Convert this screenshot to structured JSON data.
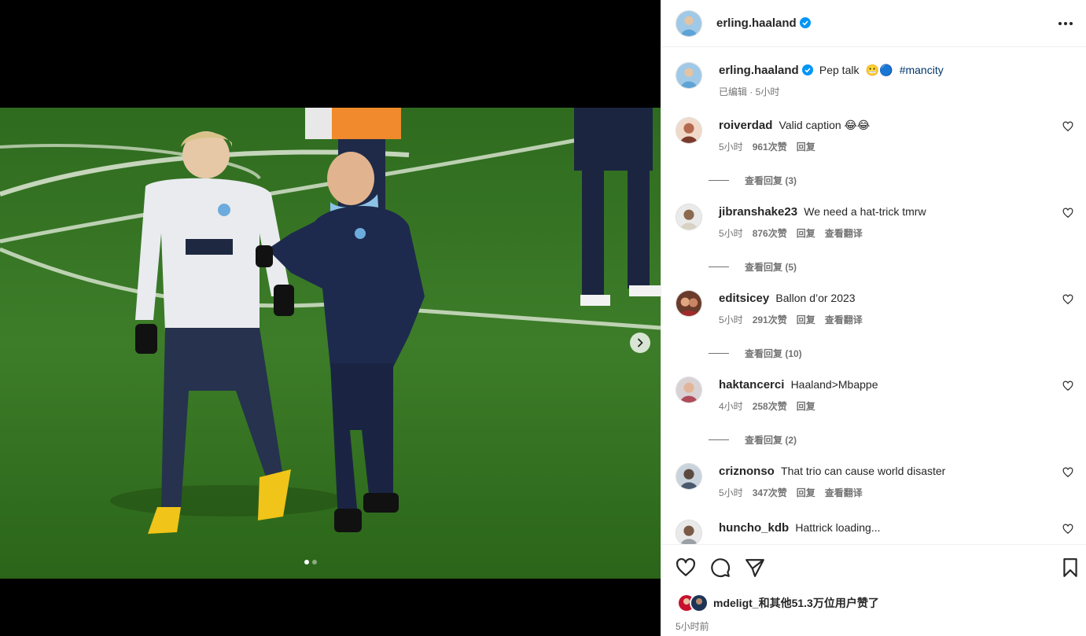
{
  "post": {
    "username": "erling.haaland",
    "caption_text": "Pep talk",
    "caption_emoji": "😬🔵",
    "hashtag": "#mancity",
    "edited_label": "已编辑 · 5小时",
    "verified_icon": "verified-badge-icon",
    "carousel": {
      "total": 2,
      "current": 1
    }
  },
  "comments": [
    {
      "username": "roiverdad",
      "text": "Valid caption 😂😂",
      "time": "5小时",
      "likes": "961次赞",
      "reply": "回复",
      "translate": "",
      "view_replies": "查看回复 (3)"
    },
    {
      "username": "jibranshake23",
      "text": "We need a hat-trick tmrw",
      "time": "5小时",
      "likes": "876次赞",
      "reply": "回复",
      "translate": "查看翻译",
      "view_replies": "查看回复 (5)"
    },
    {
      "username": "editsicey",
      "text": "Ballon d’or 2023",
      "time": "5小时",
      "likes": "291次赞",
      "reply": "回复",
      "translate": "查看翻译",
      "view_replies": "查看回复 (10)"
    },
    {
      "username": "haktancerci",
      "text": "Haaland>Mbappe",
      "time": "4小时",
      "likes": "258次赞",
      "reply": "回复",
      "translate": "",
      "view_replies": "查看回复 (2)"
    },
    {
      "username": "criznonso",
      "text": "That trio can cause world disaster",
      "time": "5小时",
      "likes": "347次赞",
      "reply": "回复",
      "translate": "查看翻译",
      "view_replies": ""
    },
    {
      "username": "huncho_kdb",
      "text": "Hattrick loading...",
      "time": "",
      "likes": "",
      "reply": "",
      "translate": "",
      "view_replies": ""
    }
  ],
  "likes_summary": "mdeligt_和其他51.3万位用户赞了",
  "time_ago": "5小时前",
  "icons": {
    "like": "heart-icon",
    "comment": "comment-icon",
    "share": "send-icon",
    "save": "bookmark-icon",
    "more": "more-options-icon",
    "next": "chevron-right-icon"
  },
  "colors": {
    "verified": "#0095f6",
    "hashtag": "#00376b",
    "secondary_text": "#737373",
    "pitch_green": "#3f7a2a",
    "city_blue": "#6cabdd"
  }
}
